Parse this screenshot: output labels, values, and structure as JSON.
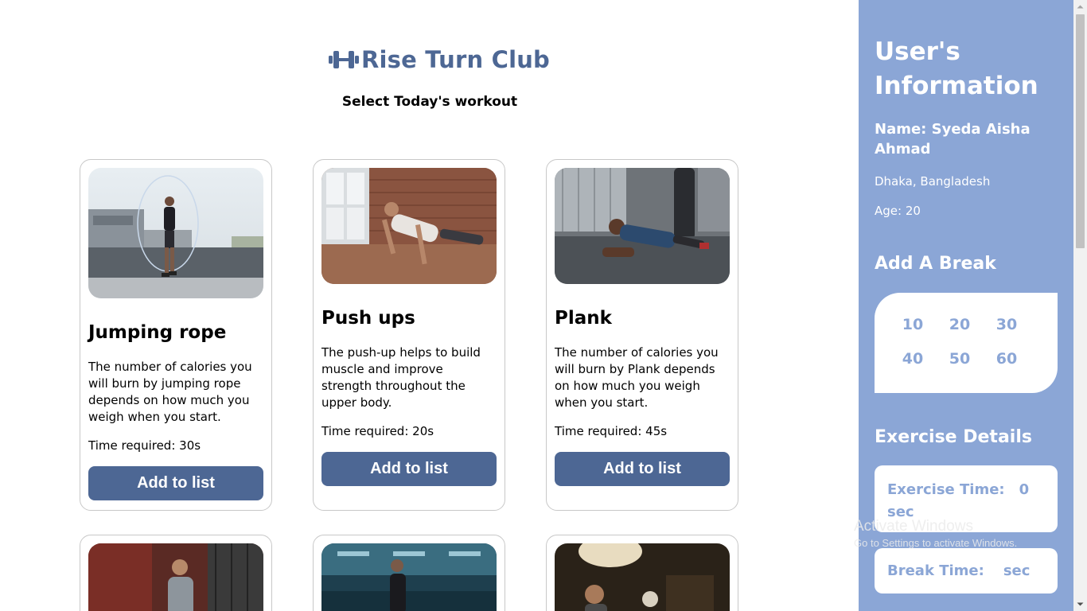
{
  "header": {
    "brand": "Rise Turn Club",
    "brand_icon": "dumbbell-icon",
    "subtitle": "Select Today's workout"
  },
  "cards": [
    {
      "title": "Jumping rope",
      "desc": "The number of calories you will burn by jumping rope depends on how much you weigh when you start.",
      "time": "Time required: 30s",
      "button": "Add to list"
    },
    {
      "title": "Push ups",
      "desc": "The push-up helps to build muscle and improve strength throughout the upper body.",
      "time": "Time required: 20s",
      "button": "Add to list"
    },
    {
      "title": "Plank",
      "desc": "The number of calories you will burn by Plank depends on how much you weigh when you start.",
      "time": "Time required: 45s",
      "button": "Add to list"
    }
  ],
  "sidebar": {
    "title": "User's Information",
    "name": "Name: Syeda Aisha Ahmad",
    "location": "Dhaka, Bangladesh",
    "age": "Age: 20",
    "break_title": "Add A Break",
    "break_options": [
      "10",
      "20",
      "30",
      "40",
      "50",
      "60"
    ],
    "exercise_title": "Exercise Details",
    "exercise_time_label": "Exercise Time:",
    "exercise_time_value": "0",
    "exercise_time_unit": "sec",
    "break_time_label": "Break Time:",
    "break_time_unit": "sec"
  },
  "watermark": {
    "line1": "Activate Windows",
    "line2": "Go to Settings to activate Windows."
  },
  "colors": {
    "brand": "#4d6794",
    "sidebar": "#8ba6d6"
  }
}
